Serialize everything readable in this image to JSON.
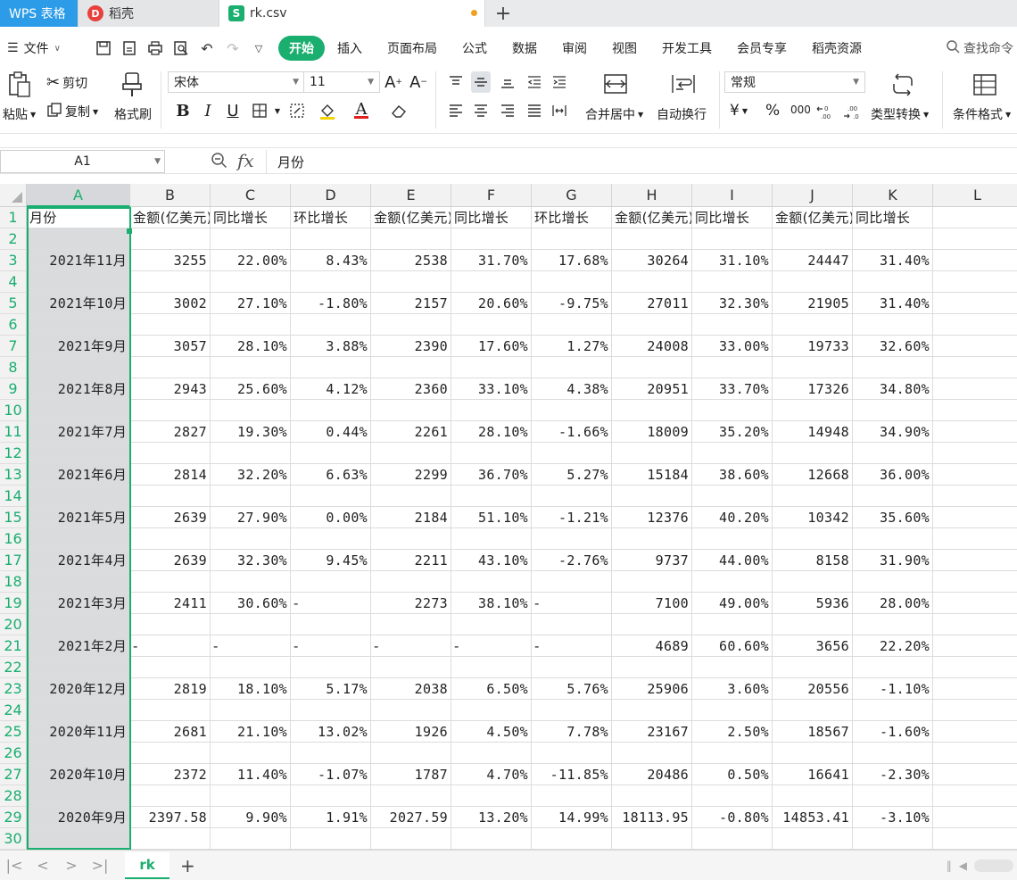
{
  "tabs": {
    "brand": "WPS 表格",
    "docer": "稻壳",
    "docer_logo": "D",
    "document": "rk.csv",
    "csv_logo": "S",
    "add": "+"
  },
  "menu": {
    "file": "文件",
    "tabs": [
      "开始",
      "插入",
      "页面布局",
      "公式",
      "数据",
      "审阅",
      "视图",
      "开发工具",
      "会员专享",
      "稻壳资源"
    ],
    "active_tab": "开始",
    "search": "查找命令",
    "accent_color": "#1aae6f"
  },
  "ribbon": {
    "paste": "粘贴",
    "cut": "剪切",
    "copy": "复制",
    "format_painter": "格式刷",
    "font_name": "宋体",
    "font_size": "11",
    "merge_center": "合并居中",
    "wrap_text": "自动换行",
    "number_format": "常规",
    "type_convert": "类型转换",
    "conditional_format": "条件格式",
    "percent_symbol": "%",
    "thousands_symbol": "000",
    "currency_symbol": "¥"
  },
  "formula_bar": {
    "cell_ref": "A1",
    "fx": "fx",
    "content": "月份"
  },
  "sheet": {
    "columns": [
      "A",
      "B",
      "C",
      "D",
      "E",
      "F",
      "G",
      "H",
      "I",
      "J",
      "K",
      "L"
    ],
    "selected_column": "A",
    "row_numbers": [
      "1",
      "2",
      "3",
      "4",
      "5",
      "6",
      "7",
      "8",
      "9",
      "10",
      "11",
      "12",
      "13",
      "14",
      "15",
      "16",
      "17",
      "18",
      "19",
      "20",
      "21",
      "22",
      "23",
      "24",
      "25",
      "26",
      "27",
      "28",
      "29",
      "30"
    ],
    "header_row": [
      "月份",
      "金额(亿美元)",
      "同比增长",
      "环比增长",
      "金额(亿美元)",
      "同比增长",
      "环比增长",
      "金额(亿美元)",
      "同比增长",
      "金额(亿美元)",
      "同比增长"
    ],
    "data_rows": [
      [
        "2021年11月",
        "3255",
        "22.00%",
        "8.43%",
        "2538",
        "31.70%",
        "17.68%",
        "30264",
        "31.10%",
        "24447",
        "31.40%"
      ],
      [
        "2021年10月",
        "3002",
        "27.10%",
        "-1.80%",
        "2157",
        "20.60%",
        "-9.75%",
        "27011",
        "32.30%",
        "21905",
        "31.40%"
      ],
      [
        "2021年9月",
        "3057",
        "28.10%",
        "3.88%",
        "2390",
        "17.60%",
        "1.27%",
        "24008",
        "33.00%",
        "19733",
        "32.60%"
      ],
      [
        "2021年8月",
        "2943",
        "25.60%",
        "4.12%",
        "2360",
        "33.10%",
        "4.38%",
        "20951",
        "33.70%",
        "17326",
        "34.80%"
      ],
      [
        "2021年7月",
        "2827",
        "19.30%",
        "0.44%",
        "2261",
        "28.10%",
        "-1.66%",
        "18009",
        "35.20%",
        "14948",
        "34.90%"
      ],
      [
        "2021年6月",
        "2814",
        "32.20%",
        "6.63%",
        "2299",
        "36.70%",
        "5.27%",
        "15184",
        "38.60%",
        "12668",
        "36.00%"
      ],
      [
        "2021年5月",
        "2639",
        "27.90%",
        "0.00%",
        "2184",
        "51.10%",
        "-1.21%",
        "12376",
        "40.20%",
        "10342",
        "35.60%"
      ],
      [
        "2021年4月",
        "2639",
        "32.30%",
        "9.45%",
        "2211",
        "43.10%",
        "-2.76%",
        "9737",
        "44.00%",
        "8158",
        "31.90%"
      ],
      [
        "2021年3月",
        "2411",
        "30.60%",
        "-",
        "2273",
        "38.10%",
        "-",
        "7100",
        "49.00%",
        "5936",
        "28.00%"
      ],
      [
        "2021年2月",
        "-",
        "-",
        "-",
        "-",
        "-",
        "-",
        "4689",
        "60.60%",
        "3656",
        "22.20%"
      ],
      [
        "2020年12月",
        "2819",
        "18.10%",
        "5.17%",
        "2038",
        "6.50%",
        "5.76%",
        "25906",
        "3.60%",
        "20556",
        "-1.10%"
      ],
      [
        "2020年11月",
        "2681",
        "21.10%",
        "13.02%",
        "1926",
        "4.50%",
        "7.78%",
        "23167",
        "2.50%",
        "18567",
        "-1.60%"
      ],
      [
        "2020年10月",
        "2372",
        "11.40%",
        "-1.07%",
        "1787",
        "4.70%",
        "-11.85%",
        "20486",
        "0.50%",
        "16641",
        "-2.30%"
      ],
      [
        "2020年9月",
        "2397.58",
        "9.90%",
        "1.91%",
        "2027.59",
        "13.20%",
        "14.99%",
        "18113.95",
        "-0.80%",
        "14853.41",
        "-3.10%"
      ]
    ],
    "sheet_tab": "rk",
    "add_sheet": "+"
  }
}
